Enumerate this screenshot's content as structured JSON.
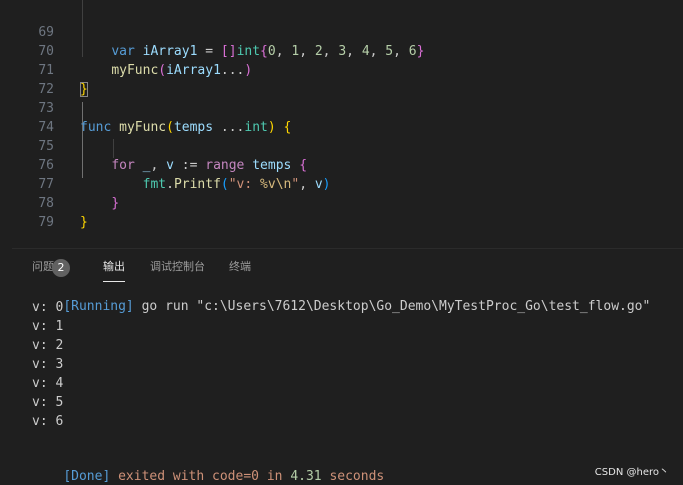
{
  "editor": {
    "lines": [
      {
        "no": "69",
        "text": "    var iArray1 = []int{0, 1, 2, 3, 4, 5, 6}"
      },
      {
        "no": "70",
        "text": "    myFunc(iArray1...)"
      },
      {
        "no": "71",
        "text": "}"
      },
      {
        "no": "72",
        "text": ""
      },
      {
        "no": "73",
        "text": "func myFunc(temps ...int) {"
      },
      {
        "no": "74",
        "text": ""
      },
      {
        "no": "75",
        "text": "    for _, v := range temps {"
      },
      {
        "no": "76",
        "text": "        fmt.Printf(\"v: %v\\n\", v)"
      },
      {
        "no": "77",
        "text": "    }"
      },
      {
        "no": "78",
        "text": "}"
      },
      {
        "no": "79",
        "text": ""
      }
    ]
  },
  "panel": {
    "tabs": [
      {
        "label": "问题",
        "badge": "2"
      },
      {
        "label": "输出"
      },
      {
        "label": "调试控制台"
      },
      {
        "label": "终端"
      }
    ],
    "active_tab": "输出"
  },
  "output": {
    "running_line": "[Running] go run \"c:\\Users\\7612\\Desktop\\Go_Demo\\MyTestProc_Go\\test_flow.go\"",
    "running_tag": "[Running]",
    "running_cmd": " go run \"c:\\Users\\7612\\Desktop\\Go_Demo\\MyTestProc_Go\\test_flow.go\"",
    "results": [
      "v: 0",
      "v: 1",
      "v: 2",
      "v: 3",
      "v: 4",
      "v: 5",
      "v: 6"
    ],
    "done_tag": "[Done]",
    "done_mid": " exited with ",
    "done_code": "code=0",
    "done_in": " in ",
    "done_time": "4.31",
    "done_end": " seconds"
  },
  "watermark": "CSDN @hero丶"
}
